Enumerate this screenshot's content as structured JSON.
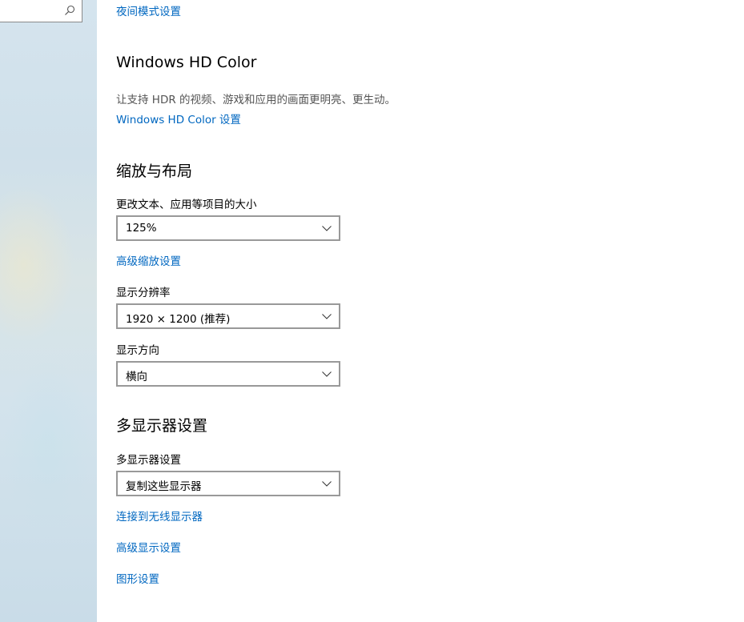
{
  "sidebar": {
    "search": {
      "value": "",
      "icon": "search-icon"
    }
  },
  "night_light": {
    "link": "夜间模式设置"
  },
  "hdr": {
    "title": "Windows HD Color",
    "description": "让支持 HDR 的视频、游戏和应用的画面更明亮、更生动。",
    "link": "Windows HD Color 设置"
  },
  "scale_layout": {
    "title": "缩放与布局",
    "scale": {
      "label": "更改文本、应用等项目的大小",
      "value": "125%"
    },
    "advanced_link": "高级缩放设置",
    "resolution": {
      "label": "显示分辨率",
      "value": "1920 × 1200 (推荐)"
    },
    "orientation": {
      "label": "显示方向",
      "value": "横向"
    }
  },
  "multi_display": {
    "title": "多显示器设置",
    "mode": {
      "label": "多显示器设置",
      "value": "复制这些显示器"
    },
    "links": {
      "wireless": "连接到无线显示器",
      "advanced": "高级显示设置",
      "graphics": "图形设置"
    }
  },
  "colors": {
    "link": "#0067c0",
    "dropdown_border": "#999999",
    "description": "#555555"
  }
}
